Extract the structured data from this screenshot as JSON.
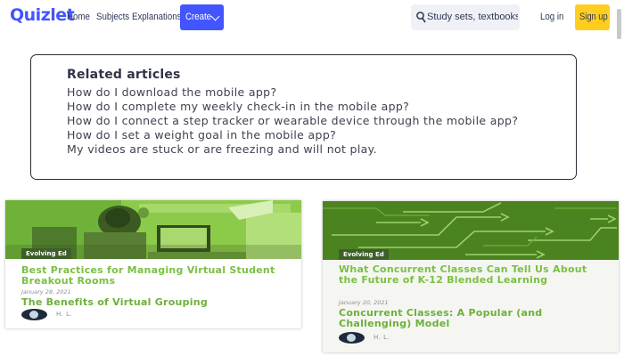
{
  "header": {
    "logo": "Quizlet",
    "nav": [
      {
        "label": "Home"
      },
      {
        "label": "Subjects"
      },
      {
        "label": "Explanations"
      }
    ],
    "create_label": "Create",
    "search_placeholder": "Study sets, textbooks, ...",
    "login_label": "Log in",
    "signup_label": "Sign up",
    "colors": {
      "brand": "#4255ff",
      "signup": "#ffcd1f"
    }
  },
  "related": {
    "title": "Related articles",
    "items": [
      "How do I download the mobile app?",
      "How do I complete my weekly check-in in the mobile app?",
      "How do I connect a step tracker or wearable device through the mobile app?",
      "How do I set a weight goal in the mobile app?",
      "My videos are stuck or are freezing and will not play."
    ]
  },
  "cards": [
    {
      "badge": "Evolving Ed",
      "title": "Best Practices for Managing Virtual Student Breakout Rooms",
      "date": "January 28, 2021",
      "subtitle": "The Benefits of Virtual Grouping",
      "author": "H. L.",
      "image_icon": "child-at-laptop-image"
    },
    {
      "badge": "Evolving Ed",
      "title": "What Concurrent Classes Can Tell Us About the Future of K-12 Blended Learning",
      "date": "January 20, 2021",
      "subtitle": "Concurrent Classes: A Popular (and Challenging) Model",
      "author": "H. L.",
      "image_icon": "arrows-pattern-image"
    }
  ],
  "accent_colors": {
    "card_title": "#7ac043",
    "badge_bg": "#3e5e2a"
  }
}
